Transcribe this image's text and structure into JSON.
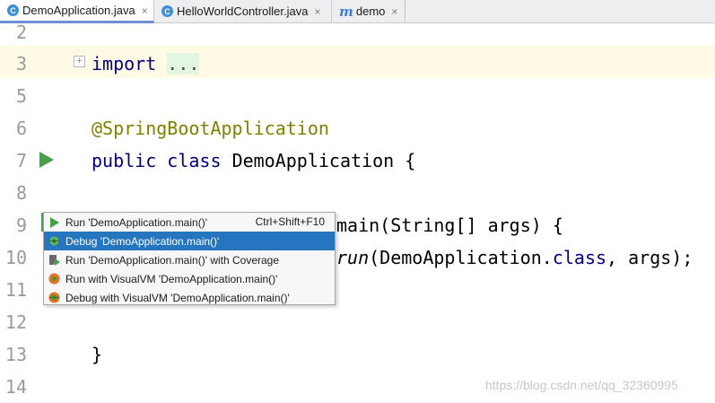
{
  "tabs": [
    {
      "label": "DemoApplication.java",
      "icon": "java-class-icon",
      "close": "×"
    },
    {
      "label": "HelloWorldController.java",
      "icon": "java-class-icon",
      "close": "×"
    },
    {
      "label": "demo",
      "icon": "maven-module-icon",
      "close": "×"
    }
  ],
  "tab_icon_glyphs": {
    "c": "C",
    "m": "m"
  },
  "lines": [
    {
      "num": "2"
    },
    {
      "num": "3",
      "kw": "import",
      "rest": "..."
    },
    {
      "num": "5"
    },
    {
      "num": "6",
      "ann": "@SpringBootApplication"
    },
    {
      "num": "7",
      "kw1": "public",
      "kw2": "class",
      "rest": "DemoApplication {"
    },
    {
      "num": "8"
    },
    {
      "num": "9",
      "rest": "main(String[] args) {"
    },
    {
      "num": "10",
      "ital": "run",
      "rest": "(DemoApplication.",
      "kw": "class",
      "rest2": ", args);"
    },
    {
      "num": "11"
    },
    {
      "num": "12"
    },
    {
      "num": "13",
      "rest": "}"
    },
    {
      "num": "14"
    }
  ],
  "popup": {
    "items": [
      {
        "label": "Run 'DemoApplication.main()'",
        "shortcut": "Ctrl+Shift+F10",
        "icon": "run-icon",
        "selected": false
      },
      {
        "label": "Debug 'DemoApplication.main()'",
        "shortcut": "",
        "icon": "debug-icon",
        "selected": true
      },
      {
        "label": "Run 'DemoApplication.main()' with Coverage",
        "shortcut": "",
        "icon": "coverage-icon",
        "selected": false
      },
      {
        "label": "Run with VisualVM 'DemoApplication.main()'",
        "shortcut": "",
        "icon": "visualvm-run-icon",
        "selected": false
      },
      {
        "label": "Debug with VisualVM 'DemoApplication.main()'",
        "shortcut": "",
        "icon": "visualvm-debug-icon",
        "selected": false
      }
    ]
  },
  "fold_marker": "+",
  "watermark": "https://blog.csdn.net/qq_32360995",
  "colors": {
    "keyword": "#000080",
    "annotation": "#808000",
    "selection": "#2675bf",
    "run_green": "#4a9e4a"
  }
}
